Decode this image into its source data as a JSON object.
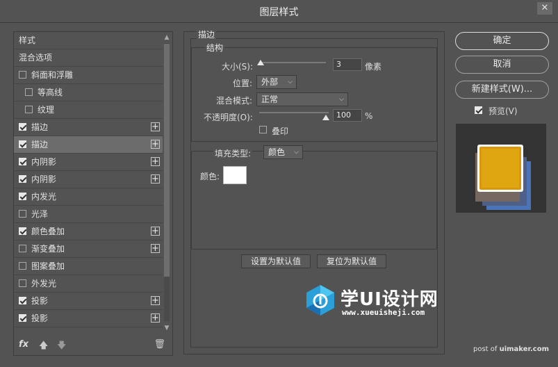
{
  "window": {
    "title": "图层样式",
    "close_glyph": "✕"
  },
  "styles_list": {
    "items": [
      {
        "label": "样式",
        "type": "header"
      },
      {
        "label": "混合选项",
        "type": "header"
      },
      {
        "label": "斜面和浮雕",
        "checked": false,
        "plus": false,
        "sub": false
      },
      {
        "label": "等高线",
        "checked": false,
        "plus": false,
        "sub": true
      },
      {
        "label": "纹理",
        "checked": false,
        "plus": false,
        "sub": true
      },
      {
        "label": "描边",
        "checked": true,
        "plus": true,
        "sub": false
      },
      {
        "label": "描边",
        "checked": true,
        "plus": true,
        "sub": false,
        "selected": true
      },
      {
        "label": "内阴影",
        "checked": true,
        "plus": true,
        "sub": false
      },
      {
        "label": "内阴影",
        "checked": true,
        "plus": true,
        "sub": false
      },
      {
        "label": "内发光",
        "checked": true,
        "plus": false,
        "sub": false
      },
      {
        "label": "光泽",
        "checked": false,
        "plus": false,
        "sub": false
      },
      {
        "label": "颜色叠加",
        "checked": true,
        "plus": true,
        "sub": false
      },
      {
        "label": "渐变叠加",
        "checked": false,
        "plus": true,
        "sub": false
      },
      {
        "label": "图案叠加",
        "checked": false,
        "plus": false,
        "sub": false
      },
      {
        "label": "外发光",
        "checked": false,
        "plus": false,
        "sub": false
      },
      {
        "label": "投影",
        "checked": true,
        "plus": true,
        "sub": false
      },
      {
        "label": "投影",
        "checked": true,
        "plus": true,
        "sub": false
      }
    ],
    "footer": {
      "fx": "fx",
      "up": "🡅",
      "down": "🡇",
      "trash": "🗑"
    }
  },
  "stroke": {
    "section_title": "描边",
    "structure_title": "结构",
    "size_label": "大小(S):",
    "size_value": "3",
    "size_unit": "像素",
    "position_label": "位置:",
    "position_value": "外部",
    "blend_label": "混合模式:",
    "blend_value": "正常",
    "opacity_label": "不透明度(O):",
    "opacity_value": "100",
    "opacity_unit": "%",
    "overprint_label": "叠印",
    "overprint_checked": false,
    "fill_type_label": "填充类型:",
    "fill_type_value": "颜色",
    "color_label": "颜色:",
    "color_value": "#ffffff",
    "set_default_label": "设置为默认值",
    "reset_default_label": "复位为默认值"
  },
  "actions": {
    "ok_label": "确定",
    "cancel_label": "取消",
    "new_style_label": "新建样式(W)...",
    "preview_label": "预览(V)",
    "preview_checked": true
  },
  "watermark": {
    "brand": "学UI设计网",
    "url": "www.xueuisheji.com",
    "credit_prefix": "post of ",
    "credit_site": "uimaker.com"
  }
}
